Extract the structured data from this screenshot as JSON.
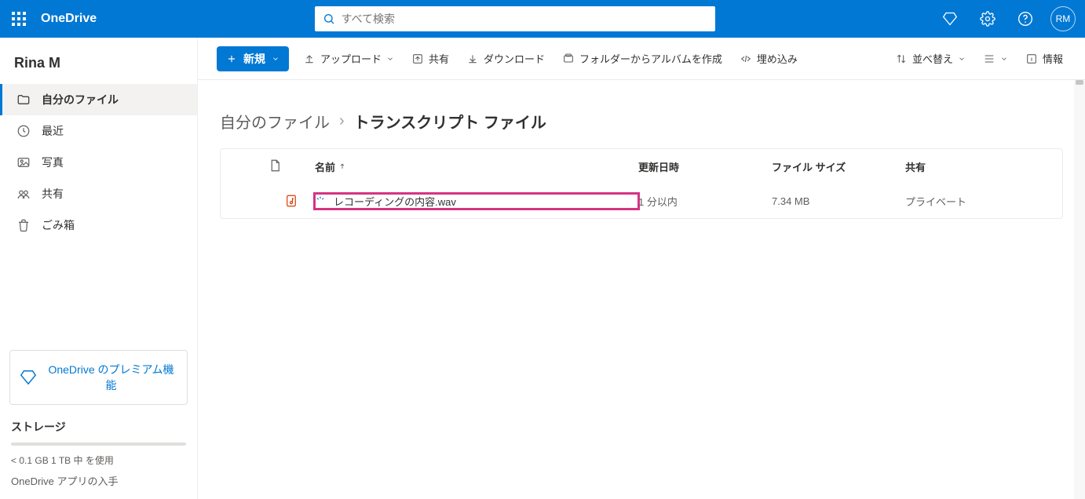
{
  "header": {
    "brand": "OneDrive",
    "search_placeholder": "すべて検索",
    "avatar_initials": "RM"
  },
  "sidebar": {
    "user": "Rina M",
    "items": [
      {
        "icon": "folder-icon",
        "label": "自分のファイル",
        "active": true
      },
      {
        "icon": "recent-icon",
        "label": "最近",
        "active": false
      },
      {
        "icon": "photo-icon",
        "label": "写真",
        "active": false
      },
      {
        "icon": "shared-icon",
        "label": "共有",
        "active": false
      },
      {
        "icon": "trash-icon",
        "label": "ごみ箱",
        "active": false
      }
    ],
    "premium_label": "OneDrive のプレミアム機能",
    "storage_header": "ストレージ",
    "storage_usage": "< 0.1 GB 1 TB 中 を使用",
    "app_link": "OneDrive アプリの入手"
  },
  "commands": {
    "new_label": "新規",
    "upload_label": "アップロード",
    "share_label": "共有",
    "download_label": "ダウンロード",
    "album_label": "フォルダーからアルバムを作成",
    "embed_label": "埋め込み",
    "sort_label": "並べ替え",
    "info_label": "情報"
  },
  "breadcrumb": {
    "parent": "自分のファイル",
    "current": "トランスクリプト ファイル"
  },
  "columns": {
    "name": "名前",
    "modified": "更新日時",
    "size": "ファイル サイズ",
    "sharing": "共有"
  },
  "files": [
    {
      "name": "レコーディングの内容.wav",
      "modified": "1 分以内",
      "size": "7.34 MB",
      "sharing": "プライベート"
    }
  ]
}
